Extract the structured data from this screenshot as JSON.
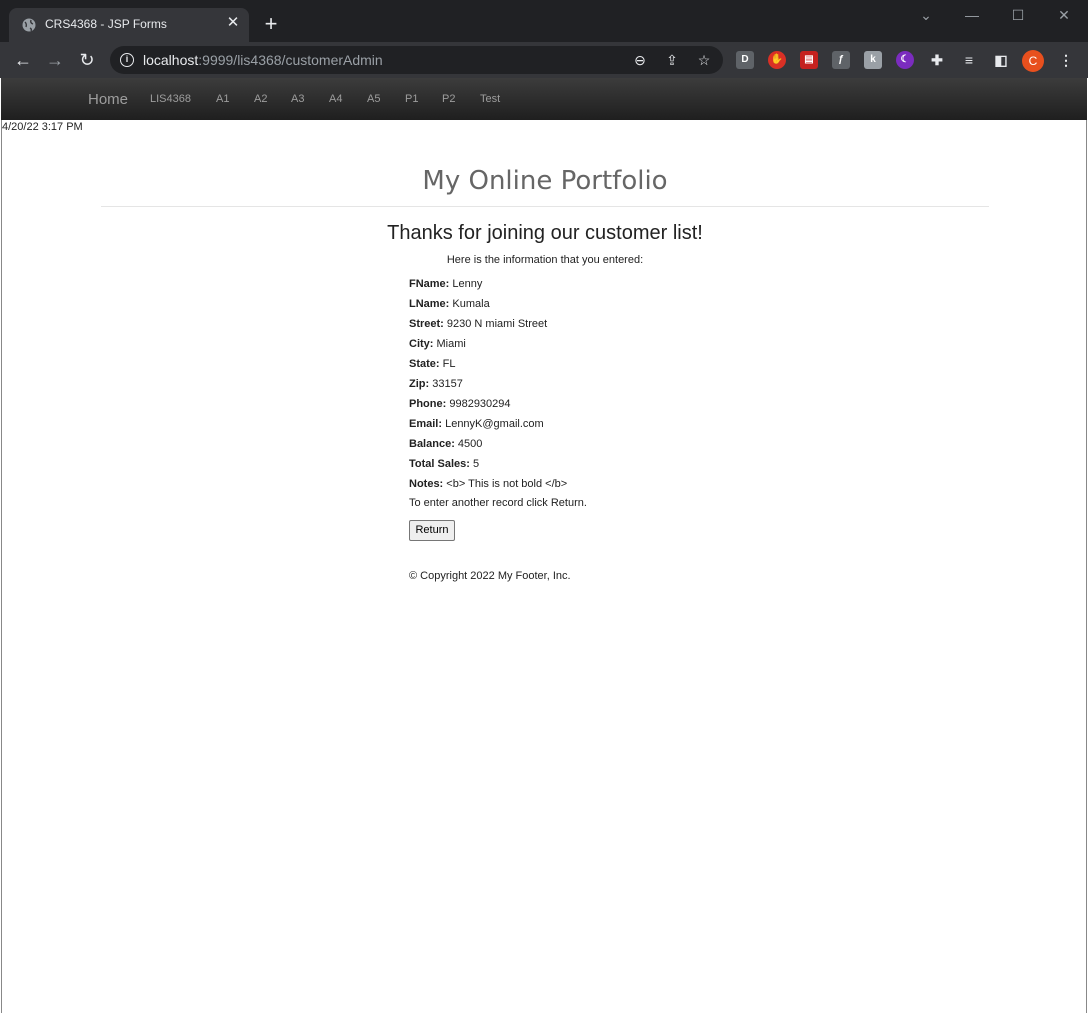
{
  "browser": {
    "tab_title": "CRS4368 - JSP Forms",
    "url_host": "localhost",
    "url_rest": ":9999/lis4368/customerAdmin",
    "avatar_letter": "C"
  },
  "nav": {
    "brand": "Home",
    "links": [
      "LIS4368",
      "A1",
      "A2",
      "A3",
      "A4",
      "A5",
      "P1",
      "P2",
      "Test"
    ]
  },
  "page": {
    "datetime": "4/20/22 3:17 PM",
    "heading": "My Online Portfolio",
    "thanks": "Thanks for joining our customer list!",
    "subtitle": "Here is the information that you entered:",
    "fields": [
      {
        "label": "FName:",
        "value": "Lenny"
      },
      {
        "label": "LName:",
        "value": "Kumala"
      },
      {
        "label": "Street:",
        "value": "9230 N miami Street"
      },
      {
        "label": "City:",
        "value": "Miami"
      },
      {
        "label": "State:",
        "value": "FL"
      },
      {
        "label": "Zip:",
        "value": "33157"
      },
      {
        "label": "Phone:",
        "value": "9982930294"
      },
      {
        "label": "Email:",
        "value": "LennyK@gmail.com"
      },
      {
        "label": "Balance:",
        "value": "4500"
      },
      {
        "label": "Total Sales:",
        "value": "5"
      },
      {
        "label": "Notes:",
        "value": "<b> This is not bold </b>"
      }
    ],
    "instructions": "To enter another record click Return.",
    "return_label": "Return",
    "footer": "© Copyright 2022 My Footer, Inc."
  }
}
